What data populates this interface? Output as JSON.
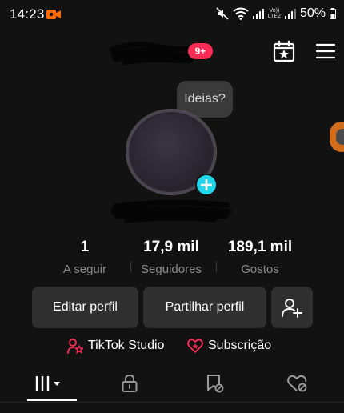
{
  "status_bar": {
    "time": "14:23",
    "volte_top": "Vo))",
    "volte_bottom": "LTE2",
    "battery": "50%"
  },
  "header": {
    "notification_count": "9+",
    "calendar_icon": "calendar-star-icon",
    "menu_icon": "hamburger-menu-icon"
  },
  "ideas_tooltip": "Ideias?",
  "profile": {
    "avatar_add_icon": "plus-icon"
  },
  "stats": [
    {
      "value": "1",
      "label": "A seguir"
    },
    {
      "value": "17,9 mil",
      "label": "Seguidores"
    },
    {
      "value": "189,1 mil",
      "label": "Gostos"
    }
  ],
  "actions": {
    "edit_label": "Editar perfil",
    "share_label": "Partilhar perfil",
    "add_friend_icon": "add-person-icon"
  },
  "links": {
    "studio_label": "TikTok Studio",
    "subscription_label": "Subscrição"
  },
  "tabs": [
    {
      "icon": "videos-grid-icon",
      "selected": true
    },
    {
      "icon": "lock-icon",
      "selected": false
    },
    {
      "icon": "bookmark-icon",
      "selected": false
    },
    {
      "icon": "liked-heart-icon",
      "selected": false
    }
  ],
  "colors": {
    "background": "#121212",
    "badge": "#fe2c55",
    "add_avatar": "#20d5ec",
    "accent_pink": "#fe2c55",
    "button_bg": "#2f2f2f",
    "muted_text": "#8a8a8a",
    "recording": "#ff6a00"
  }
}
